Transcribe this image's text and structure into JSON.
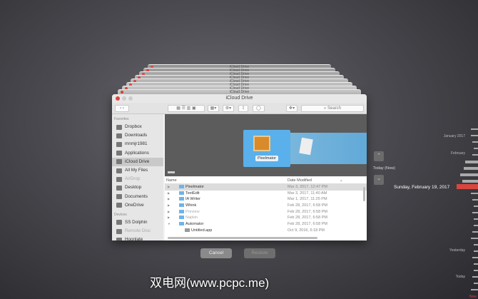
{
  "stack_titles": [
    "iCloud Drive",
    "iCloud Drive",
    "iCloud Drive",
    "iCloud Drive",
    "iCloud Drive",
    "iCloud Drive",
    "iCloud Drive",
    "iCloud Drive"
  ],
  "window": {
    "title": "iCloud Drive",
    "search_placeholder": "Search"
  },
  "sidebar": {
    "favorites_header": "Favorites",
    "favorites": [
      "Dropbox",
      "Downloads",
      "mnmjr1981",
      "Applications",
      "iCloud Drive",
      "All My Files",
      "AirDrop",
      "Desktop",
      "Documents",
      "OneDrive"
    ],
    "devices_header": "Devices",
    "devices": [
      "SS Dolphin",
      "Remote Disc",
      "Hoonlate"
    ]
  },
  "preview": {
    "selected_label": "Pixelmator"
  },
  "list": {
    "col_name": "Name",
    "col_date": "Date Modified",
    "rows": [
      {
        "name": "Pixelmator",
        "date": "Mar 3, 2017, 12:47 PM"
      },
      {
        "name": "TextEdit",
        "date": "Mar 3, 2017, 11:40 AM"
      },
      {
        "name": "IA Writer",
        "date": "Mar 1, 2017, 11:25 PM"
      },
      {
        "name": "Whink",
        "date": "Feb 28, 2017, 6:58 PM"
      },
      {
        "name": "Preview",
        "date": "Feb 28, 2017, 6:58 PM"
      },
      {
        "name": "Napkin",
        "date": "Feb 28, 2017, 6:58 PM"
      },
      {
        "name": "Automator",
        "date": "Feb 28, 2017, 6:58 PM"
      },
      {
        "name": "Untitled.app",
        "date": "Oct 9, 2016, 6:18 PM"
      }
    ]
  },
  "buttons": {
    "cancel": "Cancel",
    "restore": "Restore"
  },
  "nav": {
    "today_now": "Today (Now)",
    "current_date": "Sunday, February 19, 2017"
  },
  "timeline": {
    "labels": [
      "January 2017",
      "February",
      "Yesterday",
      "Today",
      "Now"
    ],
    "accent": "#d9453f"
  },
  "watermark": "双电网(www.pcpc.me)"
}
